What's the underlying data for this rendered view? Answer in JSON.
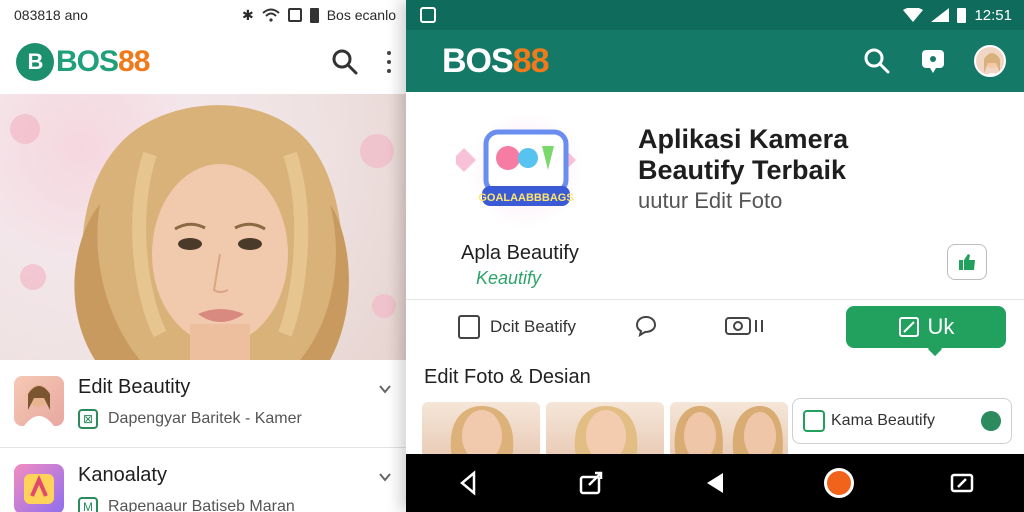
{
  "left_screen": {
    "status": {
      "time": "083818 ano",
      "right_text": "Bos ecanlo"
    },
    "appbar": {
      "logo_bos": "BOS",
      "logo_88": "88"
    },
    "list": [
      {
        "title": "Edit Beautity",
        "subtitle": "Dapengyar Baritek - Kamer"
      },
      {
        "title": "Kanoalaty",
        "subtitle": "Rapenaaur Batiseb Maran"
      }
    ]
  },
  "right_screen": {
    "status": {
      "time": "12:51"
    },
    "appbar": {
      "logo_bos": "BOS",
      "logo_88": "88"
    },
    "app": {
      "icon_caption": "GOALAABBBAGS",
      "name": "Apla Beautify",
      "subname": "Keautify",
      "title_line1": "Aplikasi Kamera",
      "title_line2": "Beautify Terbaik",
      "description": "uutur Edit Foto"
    },
    "actions": {
      "edit_label": "Dcit Beatify",
      "primary_label": "Uk"
    },
    "section_title": "Edit Foto & Desian",
    "side_card_label": "Kama Beautify"
  },
  "colors": {
    "brand_teal": "#147a67",
    "status_teal": "#0f6b5c",
    "accent_green": "#22a15e",
    "logo_orange": "#f07a1a"
  }
}
